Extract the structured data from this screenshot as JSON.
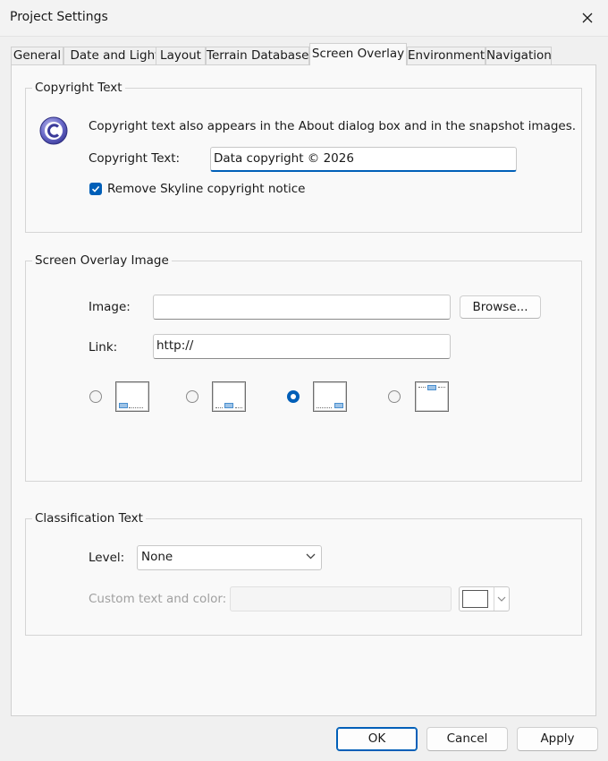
{
  "window": {
    "title": "Project Settings"
  },
  "tabs": [
    {
      "label": "General"
    },
    {
      "label": "Date and Light"
    },
    {
      "label": "Layout"
    },
    {
      "label": "Terrain Database"
    },
    {
      "label": "Screen Overlay"
    },
    {
      "label": "Environment"
    },
    {
      "label": "Navigation"
    }
  ],
  "active_tab": "Screen Overlay",
  "copyright": {
    "group_title": "Copyright Text",
    "info": "Copyright text also appears in the About dialog box and in the snapshot images.",
    "field_label": "Copyright Text:",
    "field_value": "Data copyright © 2026",
    "checkbox_label": "Remove Skyline copyright notice",
    "checkbox_checked": true,
    "icon": "copyright-icon"
  },
  "overlay": {
    "group_title": "Screen Overlay Image",
    "image_label": "Image:",
    "image_value": "",
    "browse_label": "Browse...",
    "link_label": "Link:",
    "link_value": "http://",
    "positions": [
      {
        "name": "bottom-left",
        "selected": false
      },
      {
        "name": "bottom-center",
        "selected": false
      },
      {
        "name": "bottom-right",
        "selected": true
      },
      {
        "name": "top-center",
        "selected": false
      }
    ]
  },
  "classification": {
    "group_title": "Classification Text",
    "level_label": "Level:",
    "level_value": "None",
    "custom_label": "Custom text and color:",
    "custom_value": "",
    "color": "#ffffff"
  },
  "footer": {
    "ok_label": "OK",
    "cancel_label": "Cancel",
    "apply_label": "Apply"
  },
  "colors": {
    "accent": "#005fb8",
    "background": "#f0f0f0",
    "panel": "#f9f9f9"
  }
}
